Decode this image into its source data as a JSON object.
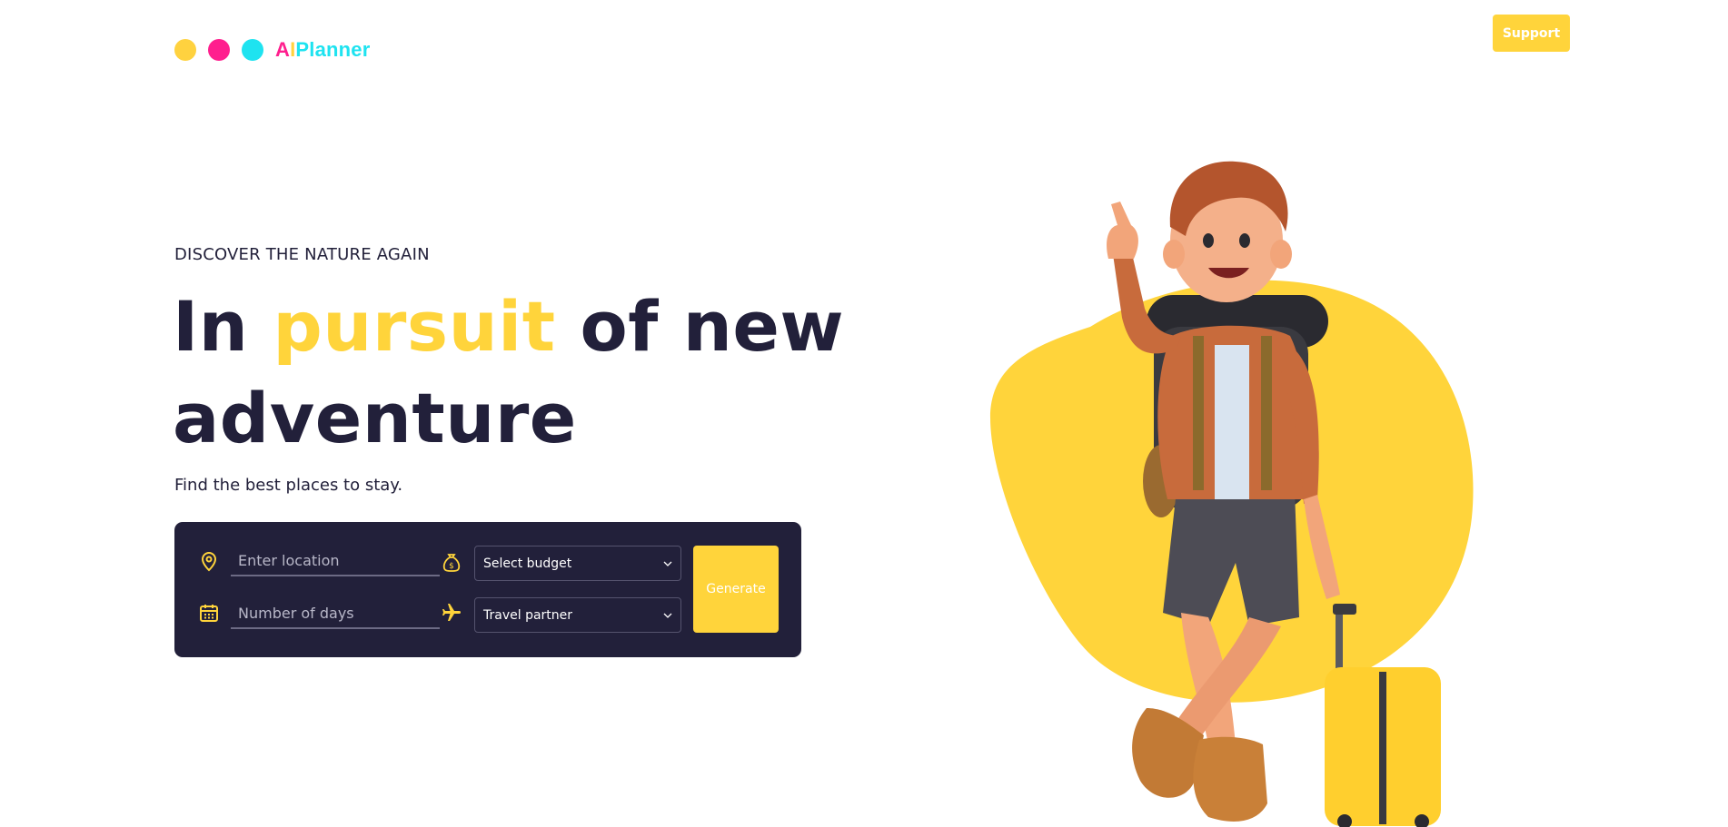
{
  "header": {
    "logo": {
      "dots": [
        "#ffd23f",
        "#ff1f8e",
        "#1ee3f0"
      ],
      "text_a": "A",
      "text_i": "I",
      "text_rest": "Planner"
    },
    "support_label": "Support"
  },
  "hero": {
    "eyebrow": "DISCOVER THE NATURE AGAIN",
    "headline_part1": "In ",
    "headline_highlight": "pursuit",
    "headline_part2": " of new",
    "headline_line2": "adventure",
    "subtitle": "Find the best places to stay."
  },
  "search": {
    "location_placeholder": "Enter location",
    "location_value": "",
    "days_placeholder": "Number of days",
    "days_value": "",
    "budget_selected": "Select budget",
    "partner_selected": "Travel partner",
    "generate_label": "Generate",
    "icons": {
      "location": "map-pin-icon",
      "budget": "money-bag-icon",
      "days": "calendar-icon",
      "partner": "airplane-icon"
    }
  },
  "colors": {
    "accent": "#ffd43b",
    "dark": "#22203a",
    "pink": "#ff1f8e",
    "cyan": "#1ee3f0",
    "text": "#ffffff"
  }
}
